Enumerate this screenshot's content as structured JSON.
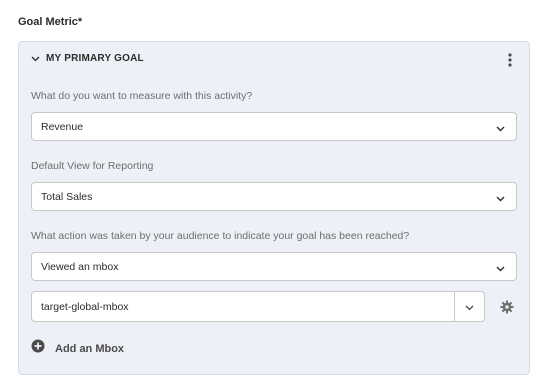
{
  "section": {
    "title": "Goal Metric*"
  },
  "goal": {
    "title": "MY PRIMARY GOAL",
    "measure": {
      "label": "What do you want to measure with this activity?",
      "value": "Revenue"
    },
    "reporting_view": {
      "label": "Default View for Reporting",
      "value": "Total Sales"
    },
    "action": {
      "label": "What action was taken by your audience to indicate your goal has been reached?",
      "value": "Viewed an mbox"
    },
    "mbox": {
      "value": "target-global-mbox"
    },
    "add_mbox_label": "Add an Mbox"
  },
  "icons": {
    "collapse": "chevron-down-icon",
    "menu": "more-vertical-icon",
    "dropdown": "chevron-down-icon",
    "settings": "gear-icon",
    "add": "add-circle-icon"
  },
  "colors": {
    "panel_bg": "#eef0f7",
    "panel_border": "#d7dbe6",
    "text": "#2c2c2c",
    "muted_text": "#6e6e6e"
  }
}
